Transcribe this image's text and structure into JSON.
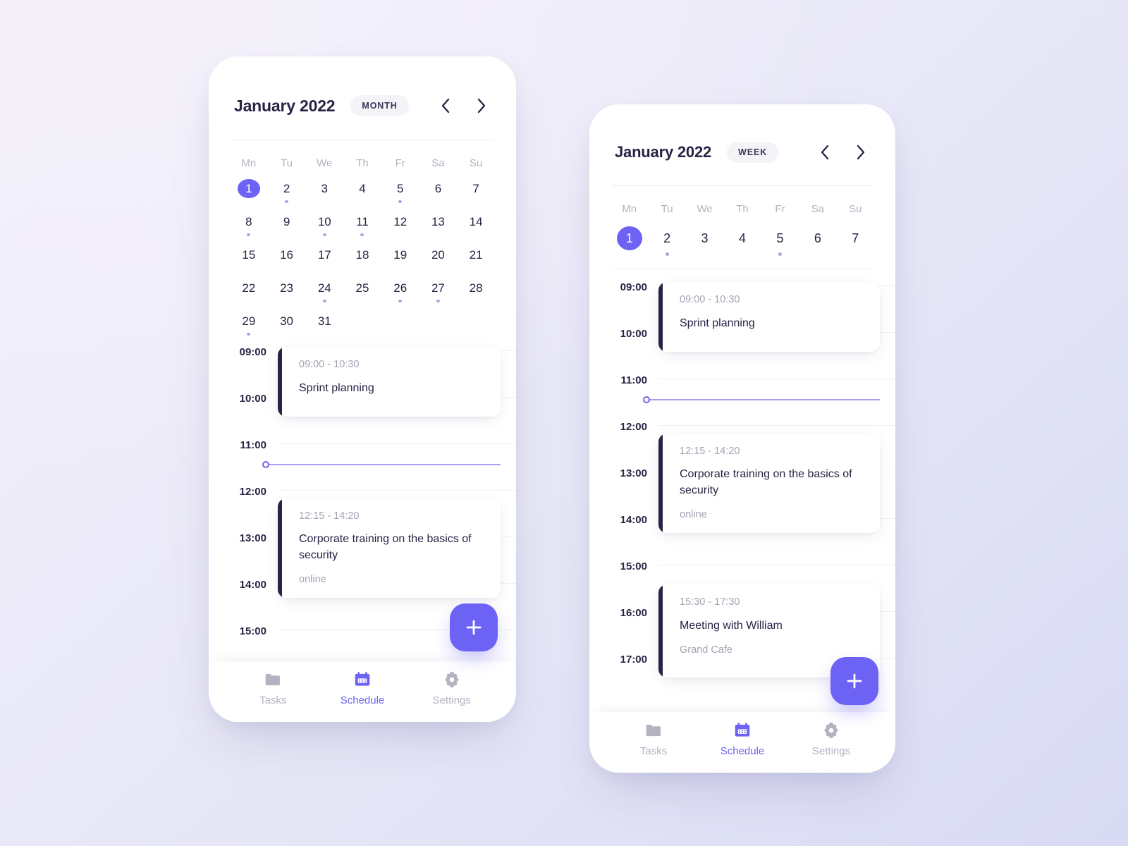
{
  "theme": {
    "accent": "#6C63F5",
    "accent_light": "#A5A0F5",
    "dark": "#272344",
    "muted": "#B4B2C0",
    "bg_from": "#F1EFFA",
    "bg_to": "#D8DAF3"
  },
  "weekdays": [
    "Mn",
    "Tu",
    "We",
    "Th",
    "Fr",
    "Sa",
    "Su"
  ],
  "phone_month": {
    "header": {
      "title": "January 2022",
      "view_label": "MONTH",
      "prev_icon": "chevron-left-icon",
      "next_icon": "chevron-right-icon"
    },
    "days": [
      {
        "n": "1",
        "selected": true,
        "dot": false
      },
      {
        "n": "2",
        "selected": false,
        "dot": true
      },
      {
        "n": "3",
        "selected": false,
        "dot": false
      },
      {
        "n": "4",
        "selected": false,
        "dot": false
      },
      {
        "n": "5",
        "selected": false,
        "dot": true
      },
      {
        "n": "6",
        "selected": false,
        "dot": false
      },
      {
        "n": "7",
        "selected": false,
        "dot": false
      },
      {
        "n": "8",
        "selected": false,
        "dot": true
      },
      {
        "n": "9",
        "selected": false,
        "dot": false
      },
      {
        "n": "10",
        "selected": false,
        "dot": true
      },
      {
        "n": "11",
        "selected": false,
        "dot": true
      },
      {
        "n": "12",
        "selected": false,
        "dot": false
      },
      {
        "n": "13",
        "selected": false,
        "dot": false
      },
      {
        "n": "14",
        "selected": false,
        "dot": false
      },
      {
        "n": "15",
        "selected": false,
        "dot": false
      },
      {
        "n": "16",
        "selected": false,
        "dot": false
      },
      {
        "n": "17",
        "selected": false,
        "dot": false
      },
      {
        "n": "18",
        "selected": false,
        "dot": false
      },
      {
        "n": "19",
        "selected": false,
        "dot": false
      },
      {
        "n": "20",
        "selected": false,
        "dot": false
      },
      {
        "n": "21",
        "selected": false,
        "dot": false
      },
      {
        "n": "22",
        "selected": false,
        "dot": false
      },
      {
        "n": "23",
        "selected": false,
        "dot": false
      },
      {
        "n": "24",
        "selected": false,
        "dot": true
      },
      {
        "n": "25",
        "selected": false,
        "dot": false
      },
      {
        "n": "26",
        "selected": false,
        "dot": true
      },
      {
        "n": "27",
        "selected": false,
        "dot": true
      },
      {
        "n": "28",
        "selected": false,
        "dot": false
      },
      {
        "n": "29",
        "selected": false,
        "dot": true
      },
      {
        "n": "30",
        "selected": false,
        "dot": false
      },
      {
        "n": "31",
        "selected": false,
        "dot": false
      }
    ],
    "schedule": {
      "hours": [
        "09:00",
        "10:00",
        "11:00",
        "12:00",
        "13:00",
        "14:00",
        "15:00"
      ],
      "now_time": "11:25",
      "events": [
        {
          "time": "09:00 - 10:30",
          "title": "Sprint planning",
          "place": ""
        },
        {
          "time": "12:15 - 14:20",
          "title": "Corporate training on the basics of security",
          "place": "online"
        }
      ]
    },
    "fab": {
      "icon": "plus-icon",
      "label": "Add event"
    },
    "nav": [
      {
        "label": "Tasks",
        "icon": "folder-icon",
        "active": false
      },
      {
        "label": "Schedule",
        "icon": "calendar-icon",
        "active": true
      },
      {
        "label": "Settings",
        "icon": "gear-icon",
        "active": false
      }
    ]
  },
  "phone_week": {
    "header": {
      "title": "January 2022",
      "view_label": "WEEK",
      "prev_icon": "chevron-left-icon",
      "next_icon": "chevron-right-icon"
    },
    "days": [
      {
        "n": "1",
        "selected": true,
        "dot": false
      },
      {
        "n": "2",
        "selected": false,
        "dot": true
      },
      {
        "n": "3",
        "selected": false,
        "dot": false
      },
      {
        "n": "4",
        "selected": false,
        "dot": false
      },
      {
        "n": "5",
        "selected": false,
        "dot": true
      },
      {
        "n": "6",
        "selected": false,
        "dot": false
      },
      {
        "n": "7",
        "selected": false,
        "dot": false
      }
    ],
    "schedule": {
      "hours": [
        "09:00",
        "10:00",
        "11:00",
        "12:00",
        "13:00",
        "14:00",
        "15:00",
        "16:00",
        "17:00"
      ],
      "now_time": "11:25",
      "events": [
        {
          "time": "09:00 - 10:30",
          "title": "Sprint planning",
          "place": ""
        },
        {
          "time": "12:15 - 14:20",
          "title": "Corporate training on the basics of security",
          "place": "online"
        },
        {
          "time": "15:30 - 17:30",
          "title": "Meeting with William",
          "place": "Grand Cafe"
        }
      ]
    },
    "fab": {
      "icon": "plus-icon",
      "label": "Add event"
    },
    "nav": [
      {
        "label": "Tasks",
        "icon": "folder-icon",
        "active": false
      },
      {
        "label": "Schedule",
        "icon": "calendar-icon",
        "active": true
      },
      {
        "label": "Settings",
        "icon": "gear-icon",
        "active": false
      }
    ]
  }
}
